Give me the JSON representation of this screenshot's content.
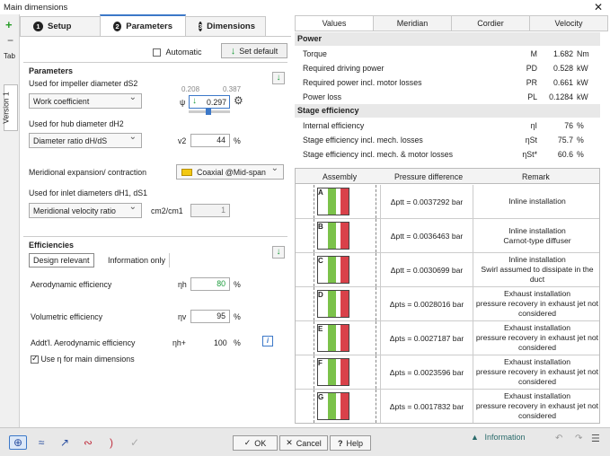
{
  "window": {
    "title": "Main dimensions",
    "close": "✕"
  },
  "leftstrip": {
    "add": "+",
    "remove": "−",
    "tab_label": "Tab",
    "version_label": "Version 1"
  },
  "tabs": [
    {
      "num": "1",
      "label": "Setup"
    },
    {
      "num": "2",
      "label": "Parameters"
    },
    {
      "num": "3",
      "label": "Dimensions"
    }
  ],
  "toolbar": {
    "automatic_label": "Automatic",
    "set_default_label": "Set default"
  },
  "parameters": {
    "title": "Parameters",
    "impeller_label": "Used for impeller diameter dS2",
    "impeller_select": "Work coefficient",
    "psi_symbol": "ψ",
    "psi_min": "0.208",
    "psi_max": "0.387",
    "psi_value": "0.297",
    "hub_label": "Used for hub diameter dH2",
    "hub_select": "Diameter ratio dH/dS",
    "v2_label": "v2",
    "v2_value": "44",
    "v2_unit": "%",
    "meridional_label": "Meridional expansion/ contraction",
    "meridional_select": "Coaxial @Mid-span",
    "inlet_label": "Used for inlet diameters dH1, dS1",
    "inlet_select": "Meridional velocity ratio",
    "cm_label": "cm2/cm1",
    "cm_value": "1"
  },
  "efficiencies": {
    "title": "Efficiencies",
    "tab_relevant": "Design relevant",
    "tab_info": "Information only",
    "aero_label": "Aerodynamic efficiency",
    "aero_symbol": "ηh",
    "aero_value": "80",
    "aero_unit": "%",
    "vol_label": "Volumetric efficiency",
    "vol_symbol": "ηv",
    "vol_value": "95",
    "vol_unit": "%",
    "addt_label": "Addt'l. Aerodynamic efficiency",
    "addt_symbol": "ηh+",
    "addt_value": "100",
    "addt_unit": "%",
    "use_eta_label": "Use η for main dimensions"
  },
  "right_tabs": [
    "Values",
    "Meridian",
    "Cordier",
    "Velocity"
  ],
  "power": {
    "title": "Power",
    "rows": [
      {
        "name": "Torque",
        "sym": "M",
        "val": "1.682",
        "unit": "Nm"
      },
      {
        "name": "Required driving power",
        "sym": "PD",
        "val": "0.528",
        "unit": "kW"
      },
      {
        "name": "Required power incl. motor losses",
        "sym": "PR",
        "val": "0.661",
        "unit": "kW"
      },
      {
        "name": "Power loss",
        "sym": "PL",
        "val": "0.1284",
        "unit": "kW"
      }
    ]
  },
  "stage": {
    "title": "Stage efficiency",
    "rows": [
      {
        "name": "Internal efficiency",
        "sym": "ηI",
        "val": "76",
        "unit": "%"
      },
      {
        "name": "Stage efficiency incl. mech. losses",
        "sym": "ηSt",
        "val": "75.7",
        "unit": "%"
      },
      {
        "name": "Stage efficiency incl. mech. & motor losses",
        "sym": "ηSt*",
        "val": "60.6",
        "unit": "%"
      }
    ]
  },
  "table": {
    "headers": [
      "Assembly",
      "Pressure difference",
      "Remark"
    ],
    "rows": [
      {
        "letter": "A",
        "dp": "Δptt = 0.0037292 bar",
        "remark": "Inline installation"
      },
      {
        "letter": "B",
        "dp": "Δptt = 0.0036463 bar",
        "remark": "Inline installation\nCarnot-type diffuser"
      },
      {
        "letter": "C",
        "dp": "Δptt = 0.0030699 bar",
        "remark": "Inline installation\nSwirl assumed to dissipate in the duct"
      },
      {
        "letter": "D",
        "dp": "Δpts = 0.0028016 bar",
        "remark": "Exhaust installation\npressure recovery in exhaust jet not considered"
      },
      {
        "letter": "E",
        "dp": "Δpts = 0.0027187 bar",
        "remark": "Exhaust installation\npressure recovery in exhaust jet not considered"
      },
      {
        "letter": "F",
        "dp": "Δpts = 0.0023596 bar",
        "remark": "Exhaust installation\npressure recovery in exhaust jet not considered"
      },
      {
        "letter": "G",
        "dp": "Δpts = 0.0017832 bar",
        "remark": "Exhaust installation\npressure recovery in exhaust jet not considered"
      }
    ]
  },
  "bottom": {
    "ok": "OK",
    "cancel": "Cancel",
    "help": "Help",
    "information": "Information"
  }
}
